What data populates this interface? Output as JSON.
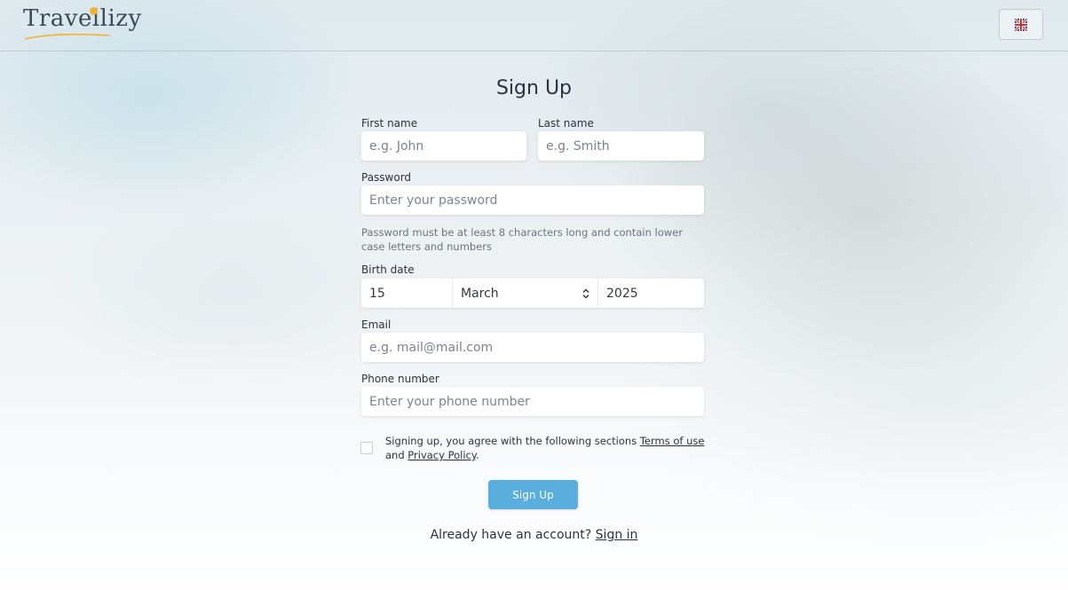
{
  "header": {
    "logo_text": "Travellizy",
    "language": "English (UK flag)"
  },
  "form": {
    "title": "Sign Up",
    "first_name": {
      "label": "First name",
      "placeholder": "e.g. John",
      "value": ""
    },
    "last_name": {
      "label": "Last name",
      "placeholder": "e.g. Smith",
      "value": ""
    },
    "password": {
      "label": "Password",
      "placeholder": "Enter your password",
      "hint": "Password must be at least 8 characters long and contain lower case letters and numbers"
    },
    "birth_date": {
      "label": "Birth date",
      "day": "15",
      "month": "March",
      "year": "2025"
    },
    "email": {
      "label": "Email",
      "placeholder": "e.g. mail@mail.com"
    },
    "phone": {
      "label": "Phone number",
      "placeholder": "Enter your phone number"
    },
    "agreement": {
      "text_before": "Signing up, you agree with the following sections ",
      "terms_link": "Terms of use",
      "text_and": " and ",
      "privacy_link": "Privacy Policy",
      "text_after": ".",
      "checked": false
    },
    "submit_label": "Sign Up",
    "signin_prompt": "Already have an account? ",
    "signin_link": "Sign in"
  },
  "colors": {
    "primary_button": "#5aaede",
    "text": "#2a3340",
    "logo_accent": "#f2b233"
  }
}
